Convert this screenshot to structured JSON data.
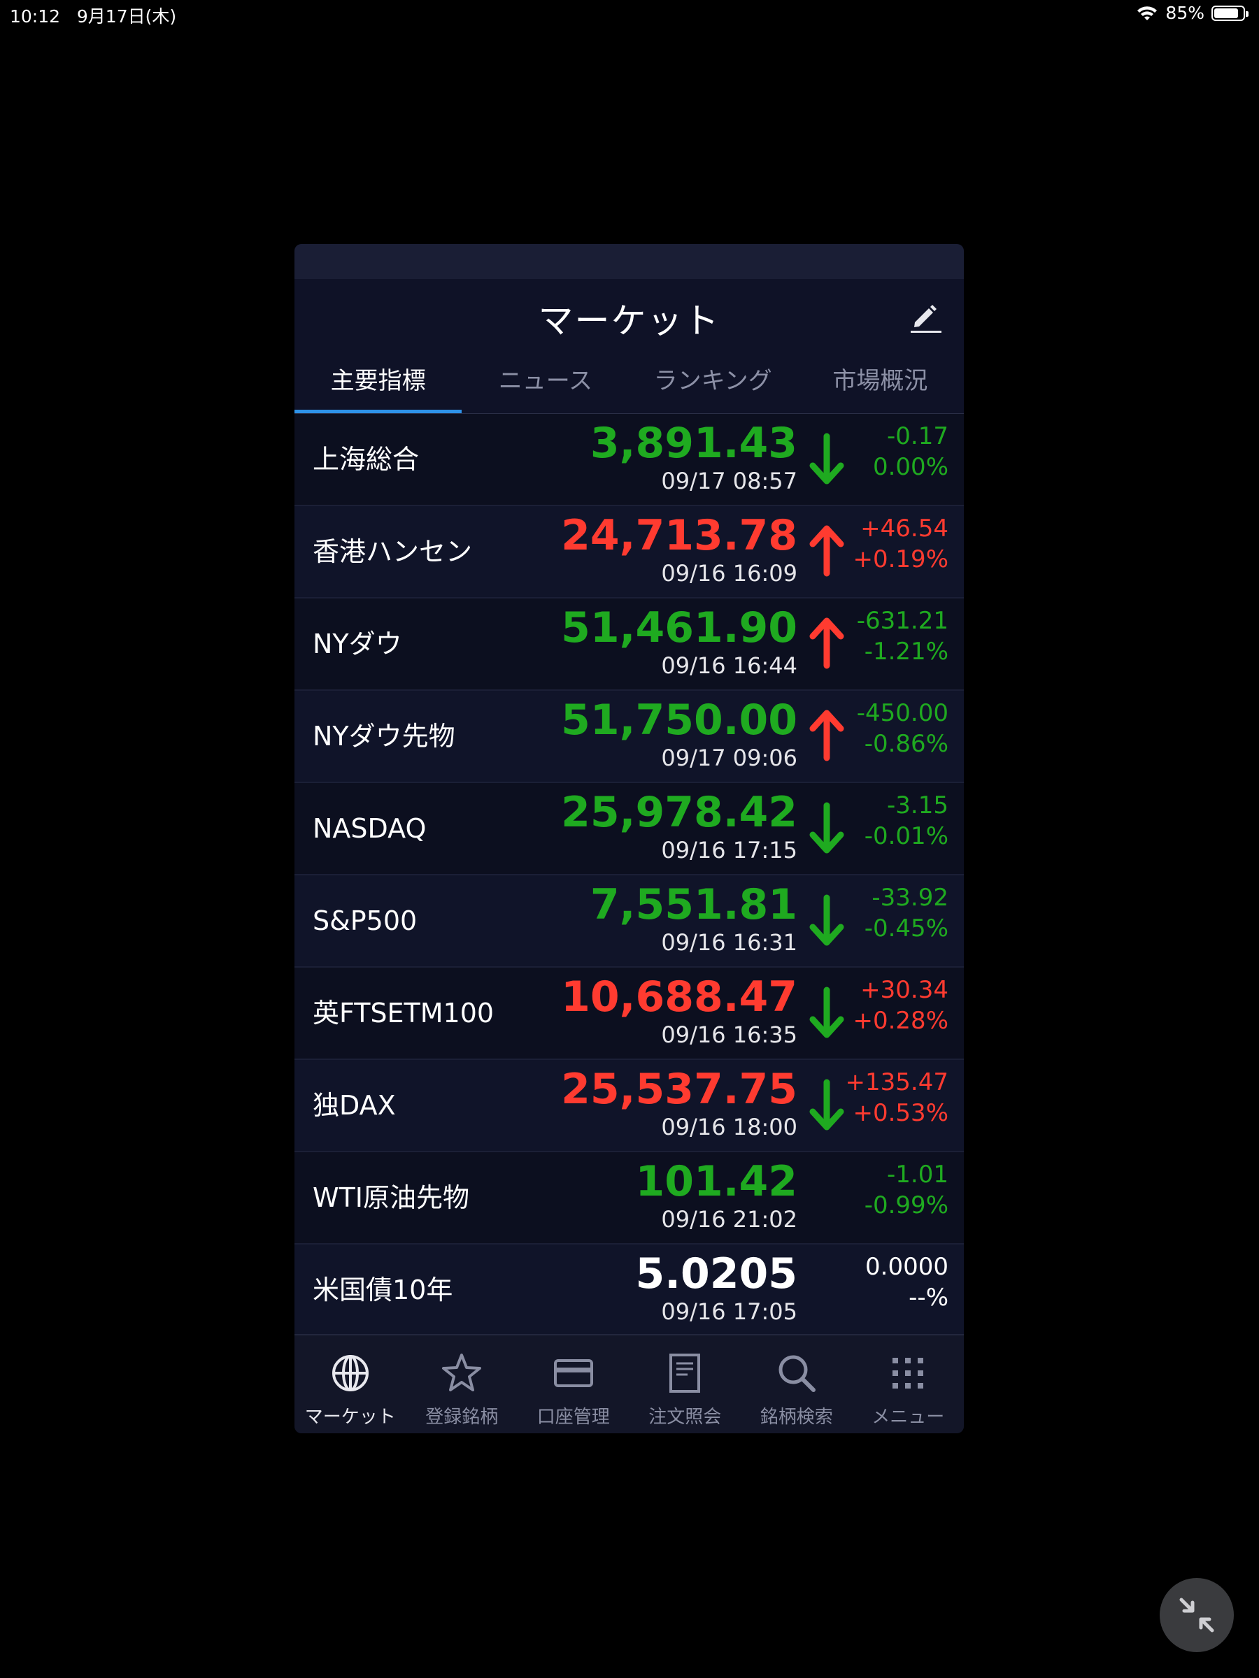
{
  "status_bar": {
    "time": "10:12",
    "date": "9月17日(木)",
    "battery": "85%"
  },
  "header": {
    "title": "マーケット"
  },
  "tabs": [
    {
      "label": "主要指標",
      "active": true
    },
    {
      "label": "ニュース",
      "active": false
    },
    {
      "label": "ランキング",
      "active": false
    },
    {
      "label": "市場概況",
      "active": false
    }
  ],
  "colors": {
    "up": "#ff3b30",
    "down": "#1faa20",
    "neutral": "#ffffff",
    "accent": "#2e92e8"
  },
  "markets": [
    {
      "name": "上海総合",
      "price": "3,891.43",
      "time": "09/17 08:57",
      "arrow": "down",
      "change": "-0.17",
      "percent": "0.00%",
      "price_color": "down",
      "change_color": "down"
    },
    {
      "name": "香港ハンセン",
      "price": "24,713.78",
      "time": "09/16 16:09",
      "arrow": "up",
      "change": "+46.54",
      "percent": "+0.19%",
      "price_color": "up",
      "change_color": "up"
    },
    {
      "name": "NYダウ",
      "price": "51,461.90",
      "time": "09/16 16:44",
      "arrow": "up",
      "change": "-631.21",
      "percent": "-1.21%",
      "price_color": "down",
      "change_color": "down"
    },
    {
      "name": "NYダウ先物",
      "price": "51,750.00",
      "time": "09/17 09:06",
      "arrow": "up",
      "change": "-450.00",
      "percent": "-0.86%",
      "price_color": "down",
      "change_color": "down"
    },
    {
      "name": "NASDAQ",
      "price": "25,978.42",
      "time": "09/16 17:15",
      "arrow": "down",
      "change": "-3.15",
      "percent": "-0.01%",
      "price_color": "down",
      "change_color": "down"
    },
    {
      "name": "S&P500",
      "price": "7,551.81",
      "time": "09/16 16:31",
      "arrow": "down",
      "change": "-33.92",
      "percent": "-0.45%",
      "price_color": "down",
      "change_color": "down"
    },
    {
      "name": "英FTSETM100",
      "price": "10,688.47",
      "time": "09/16 16:35",
      "arrow": "down",
      "change": "+30.34",
      "percent": "+0.28%",
      "price_color": "up",
      "change_color": "up"
    },
    {
      "name": "独DAX",
      "price": "25,537.75",
      "time": "09/16 18:00",
      "arrow": "down",
      "change": "+135.47",
      "percent": "+0.53%",
      "price_color": "up",
      "change_color": "up"
    },
    {
      "name": "WTI原油先物",
      "price": "101.42",
      "time": "09/16 21:02",
      "arrow": "none",
      "change": "-1.01",
      "percent": "-0.99%",
      "price_color": "down",
      "change_color": "down"
    },
    {
      "name": "米国債10年",
      "price": "5.0205",
      "time": "09/16 17:05",
      "arrow": "none",
      "change": "0.0000",
      "percent": "--%",
      "price_color": "neutral",
      "change_color": "neutral"
    }
  ],
  "bottom_nav": [
    {
      "label": "マーケット",
      "icon": "globe-icon",
      "active": true
    },
    {
      "label": "登録銘柄",
      "icon": "star-icon",
      "active": false
    },
    {
      "label": "口座管理",
      "icon": "card-icon",
      "active": false
    },
    {
      "label": "注文照会",
      "icon": "document-icon",
      "active": false
    },
    {
      "label": "銘柄検索",
      "icon": "search-icon",
      "active": false
    },
    {
      "label": "メニュー",
      "icon": "grid-menu-icon",
      "active": false
    }
  ]
}
